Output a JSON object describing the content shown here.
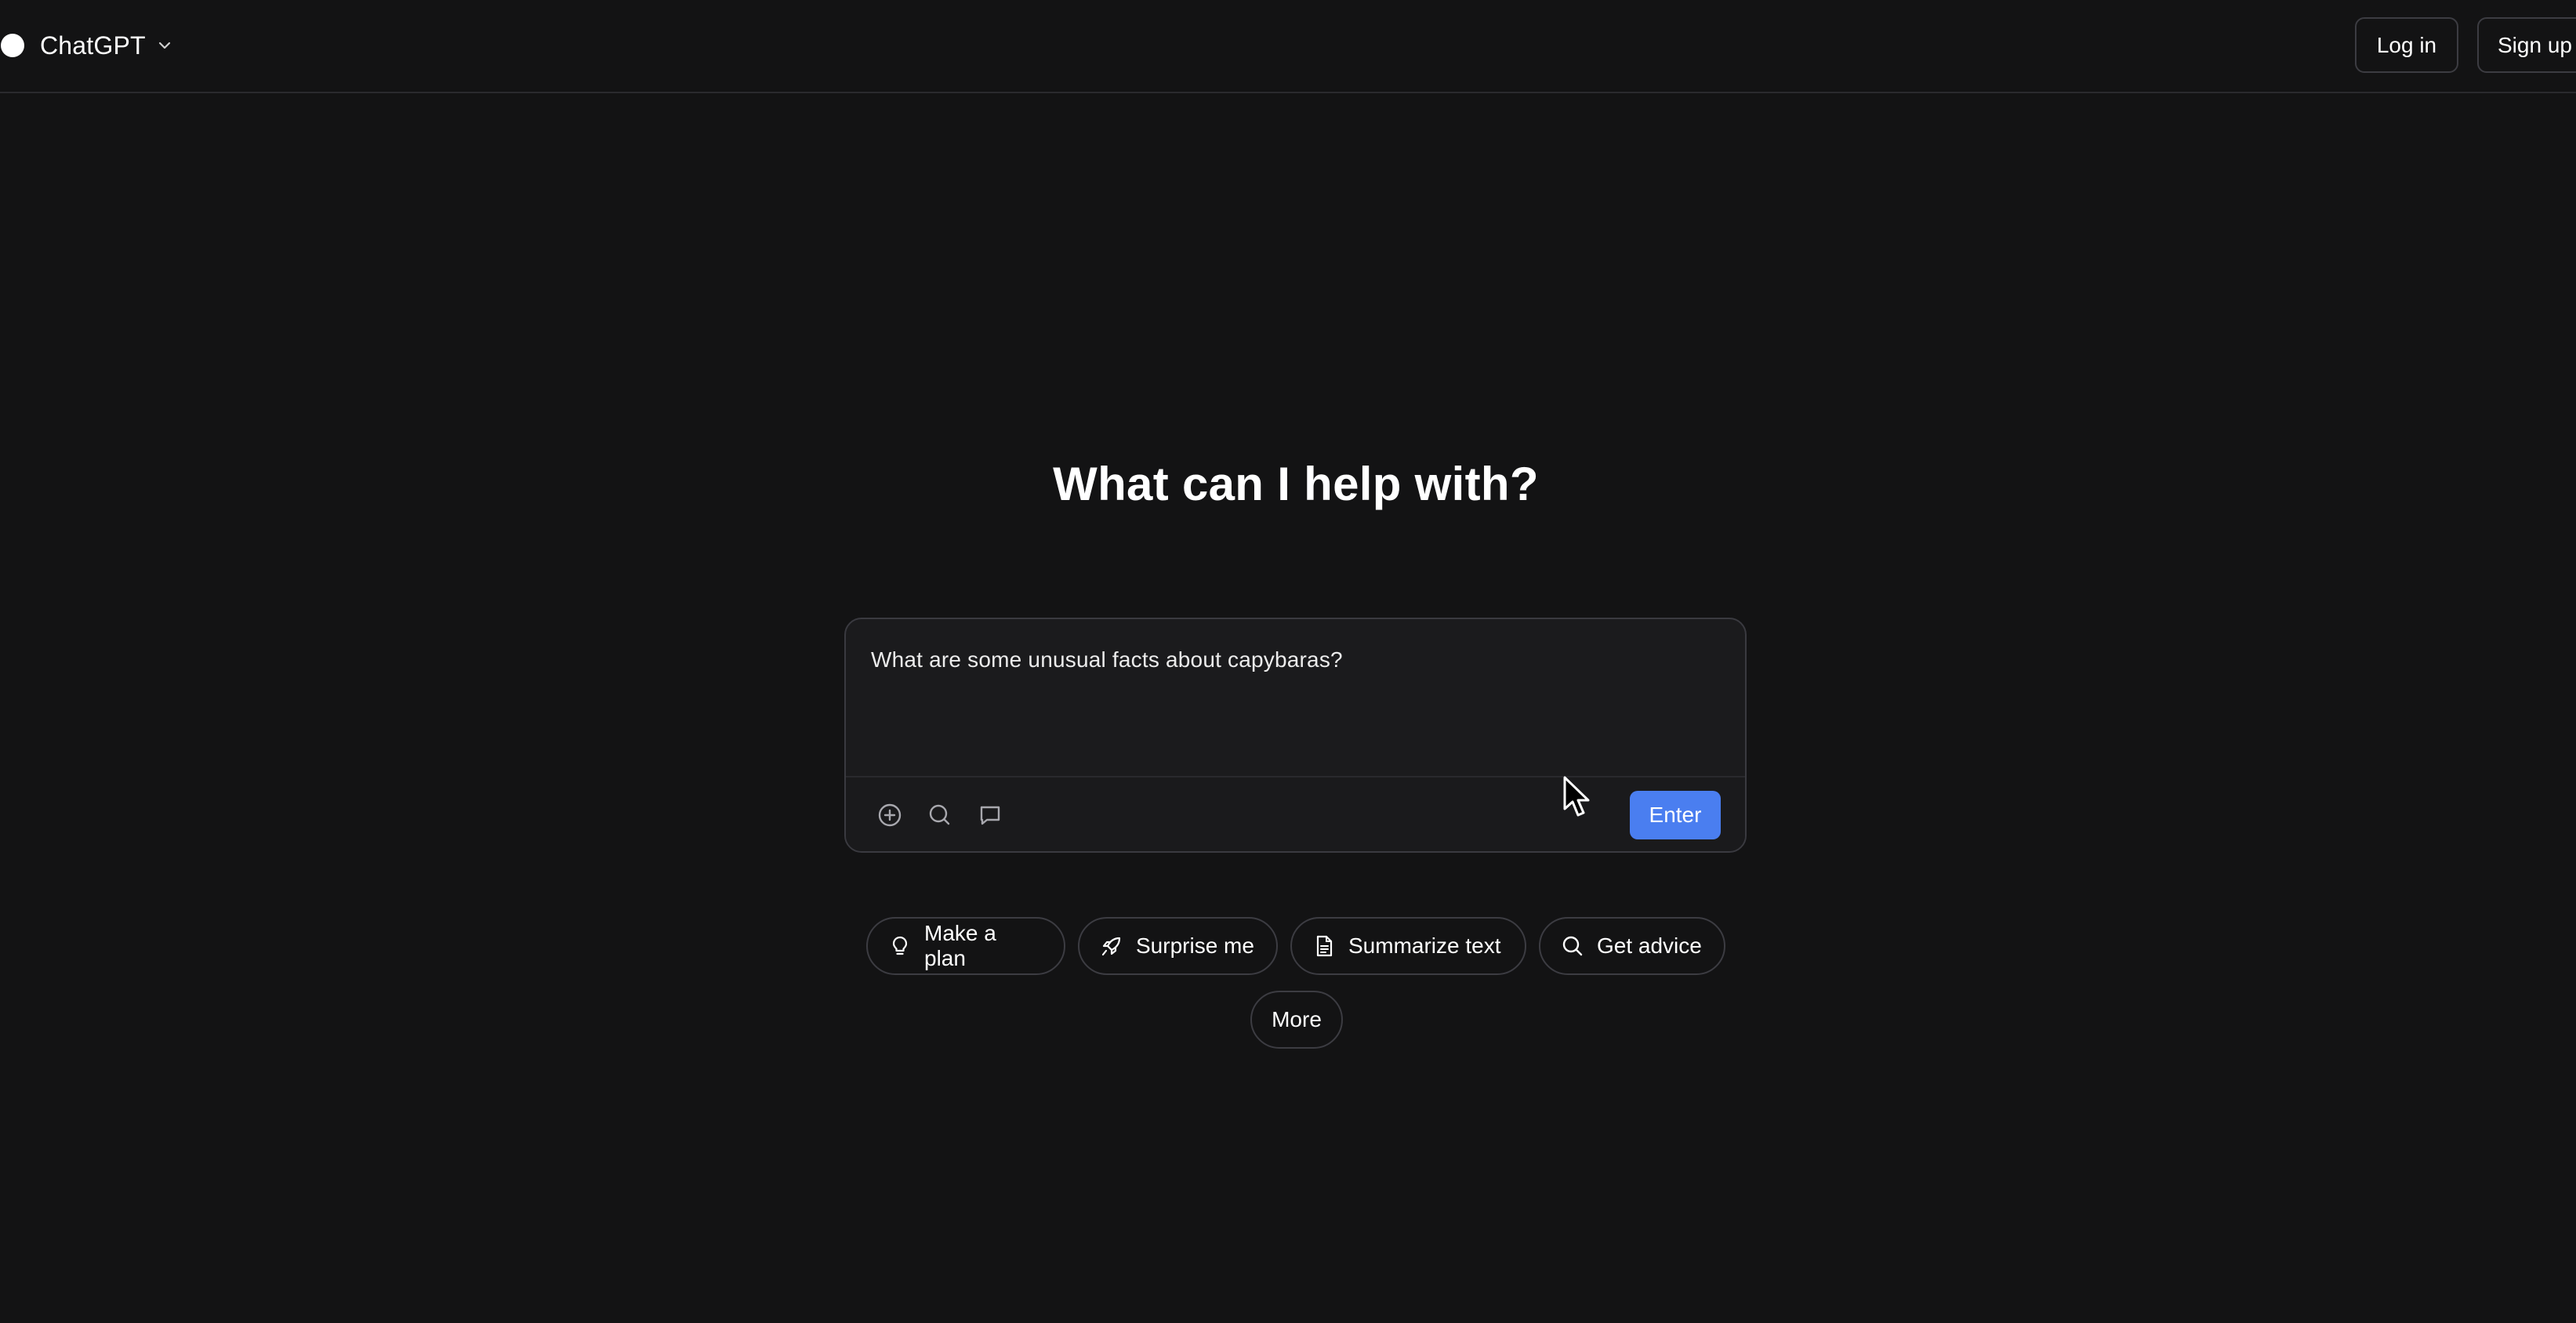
{
  "header": {
    "brand_name": "ChatGPT",
    "login_label": "Log in",
    "signup_label": "Sign up"
  },
  "hero": {
    "title": "What can I help with?"
  },
  "composer": {
    "input_value": "What are some unusual facts about capybaras?",
    "enter_label": "Enter",
    "tools": [
      "add-circle-icon",
      "search-icon",
      "chat-bubble-icon"
    ]
  },
  "suggestions": [
    {
      "label": "Make a plan",
      "icon": "lightbulb-icon"
    },
    {
      "label": "Surprise me",
      "icon": "rocket-icon"
    },
    {
      "label": "Summarize text",
      "icon": "document-icon"
    },
    {
      "label": "Get advice",
      "icon": "search-icon"
    },
    {
      "label": "More",
      "icon": ""
    }
  ],
  "colors": {
    "background": "#131314",
    "accent": "#4a7ef0",
    "border": "#3c3c42",
    "text": "#ffffff"
  }
}
